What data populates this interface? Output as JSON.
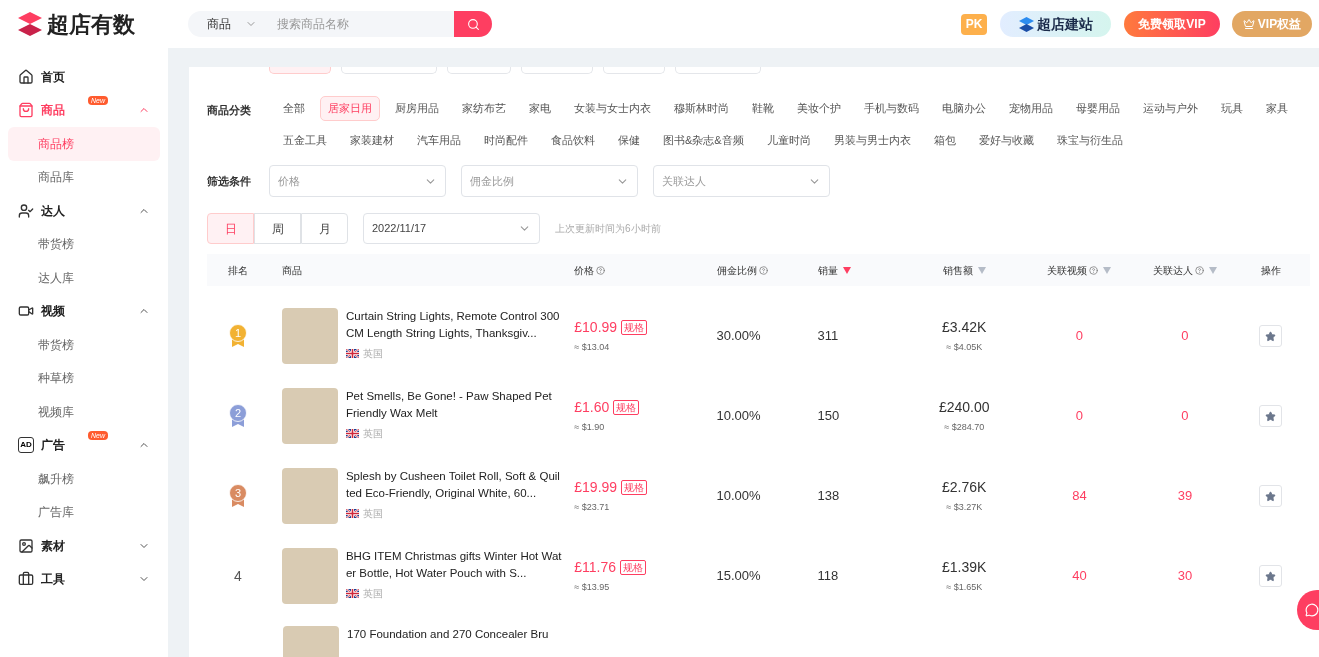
{
  "header": {
    "logo_text": "超店有数",
    "search_scope": "商品",
    "search_placeholder": "搜索商品名称",
    "pk_badge": "PK",
    "site_button": "超店建站",
    "vip_free_button": "免费领取VIP",
    "vip_rights_button": "VIP权益"
  },
  "sidebar": {
    "items": [
      {
        "label": "首页",
        "kind": "home",
        "active": false
      },
      {
        "label": "商品",
        "kind": "bag",
        "expanded": true,
        "badge": "New",
        "active": true,
        "children": [
          {
            "label": "商品榜",
            "selected": true
          },
          {
            "label": "商品库",
            "selected": false
          }
        ]
      },
      {
        "label": "达人",
        "kind": "user",
        "expanded": true,
        "active": false,
        "children": [
          {
            "label": "带货榜",
            "selected": false
          },
          {
            "label": "达人库",
            "selected": false
          }
        ]
      },
      {
        "label": "视频",
        "kind": "video",
        "expanded": true,
        "active": false,
        "children": [
          {
            "label": "带货榜",
            "selected": false
          },
          {
            "label": "种草榜",
            "selected": false
          },
          {
            "label": "视频库",
            "selected": false
          }
        ]
      },
      {
        "label": "广告",
        "kind": "ad",
        "icon_text": "AD",
        "expanded": true,
        "badge": "New",
        "active": false,
        "children": [
          {
            "label": "飙升榜",
            "selected": false
          },
          {
            "label": "广告库",
            "selected": false
          }
        ]
      },
      {
        "label": "素材",
        "kind": "material",
        "expanded": false,
        "active": false
      },
      {
        "label": "工具",
        "kind": "tool",
        "expanded": false,
        "active": false
      }
    ]
  },
  "scrolled_pills": [
    {
      "selected": true
    },
    {
      "selected": false
    },
    {
      "selected": false
    },
    {
      "selected": false
    },
    {
      "selected": false
    },
    {
      "selected": false
    }
  ],
  "category": {
    "label": "商品分类",
    "options": [
      {
        "label": "全部",
        "selected": false
      },
      {
        "label": "居家日用",
        "selected": true
      },
      {
        "label": "厨房用品",
        "selected": false
      },
      {
        "label": "家纺布艺",
        "selected": false
      },
      {
        "label": "家电",
        "selected": false
      },
      {
        "label": "女装与女士内衣",
        "selected": false
      },
      {
        "label": "穆斯林时尚",
        "selected": false
      },
      {
        "label": "鞋靴",
        "selected": false
      },
      {
        "label": "美妆个护",
        "selected": false
      },
      {
        "label": "手机与数码",
        "selected": false
      },
      {
        "label": "电脑办公",
        "selected": false
      },
      {
        "label": "宠物用品",
        "selected": false
      },
      {
        "label": "母婴用品",
        "selected": false
      },
      {
        "label": "运动与户外",
        "selected": false
      },
      {
        "label": "玩具",
        "selected": false
      },
      {
        "label": "家具",
        "selected": false
      },
      {
        "label": "五金工具",
        "selected": false
      },
      {
        "label": "家装建材",
        "selected": false
      },
      {
        "label": "汽车用品",
        "selected": false
      },
      {
        "label": "时尚配件",
        "selected": false
      },
      {
        "label": "食品饮料",
        "selected": false
      },
      {
        "label": "保健",
        "selected": false
      },
      {
        "label": "图书&杂志&音频",
        "selected": false
      },
      {
        "label": "儿童时尚",
        "selected": false
      },
      {
        "label": "男装与男士内衣",
        "selected": false
      },
      {
        "label": "箱包",
        "selected": false
      },
      {
        "label": "爱好与收藏",
        "selected": false
      },
      {
        "label": "珠宝与衍生品",
        "selected": false
      }
    ]
  },
  "filters": {
    "label": "筛选条件",
    "selects": [
      {
        "placeholder": "价格"
      },
      {
        "placeholder": "佣金比例"
      },
      {
        "placeholder": "关联达人"
      }
    ]
  },
  "period_tabs": [
    {
      "label": "日",
      "selected": true
    },
    {
      "label": "周",
      "selected": false
    },
    {
      "label": "月",
      "selected": false
    }
  ],
  "date": "2022/11/17",
  "update_note": "上次更新时间为6小时前",
  "table": {
    "columns": [
      {
        "label": "排名",
        "help": false
      },
      {
        "label": "商品",
        "help": false
      },
      {
        "label": "价格",
        "help": true
      },
      {
        "label": "佣金比例",
        "help": true
      },
      {
        "label": "销量",
        "sorted": true,
        "help": false
      },
      {
        "label": "销售额",
        "sorted": false,
        "help": false
      },
      {
        "label": "关联视频",
        "sorted": false,
        "help": true
      },
      {
        "label": "关联达人",
        "sorted": false,
        "help": true
      },
      {
        "label": "操作",
        "help": false
      }
    ],
    "rows": [
      {
        "rank": "1",
        "color": "#f2b233",
        "name": "Curtain String Lights, Remote Control 300CM Length String Lights, Thanksgiv...",
        "country": "英国",
        "price": "£10.99",
        "spec": "规格",
        "price_usd": "≈ $13.04",
        "commission": "30.00%",
        "sales": "311",
        "amount": "£3.42K",
        "amount_usd": "≈ $4.05K",
        "videos": "0",
        "creators": "0"
      },
      {
        "rank": "2",
        "color": "#8c9ed8",
        "name": "Pet Smells, Be Gone! - Paw Shaped Pet Friendly Wax Melt",
        "country": "英国",
        "price": "£1.60",
        "spec": "规格",
        "price_usd": "≈ $1.90",
        "commission": "10.00%",
        "sales": "150",
        "amount": "£240.00",
        "amount_usd": "≈ $284.70",
        "videos": "0",
        "creators": "0"
      },
      {
        "rank": "3",
        "color": "#d98b62",
        "name": "Splesh by Cusheen Toilet Roll, Soft & Quilted Eco-Friendly, Original White, 60...",
        "country": "英国",
        "price": "£19.99",
        "spec": "规格",
        "price_usd": "≈ $23.71",
        "commission": "10.00%",
        "sales": "138",
        "amount": "£2.76K",
        "amount_usd": "≈ $3.27K",
        "videos": "84",
        "creators": "39"
      },
      {
        "rank": "4",
        "name": "BHG ITEM Christmas gifts Winter Hot Water Bottle, Hot Water Pouch with S...",
        "country": "英国",
        "price": "£11.76",
        "spec": "规格",
        "price_usd": "≈ $13.95",
        "commission": "15.00%",
        "sales": "118",
        "amount": "£1.39K",
        "amount_usd": "≈ $1.65K",
        "videos": "40",
        "creators": "30"
      },
      {
        "partial": true,
        "name": "170 Foundation and 270 Concealer Bru"
      }
    ]
  }
}
